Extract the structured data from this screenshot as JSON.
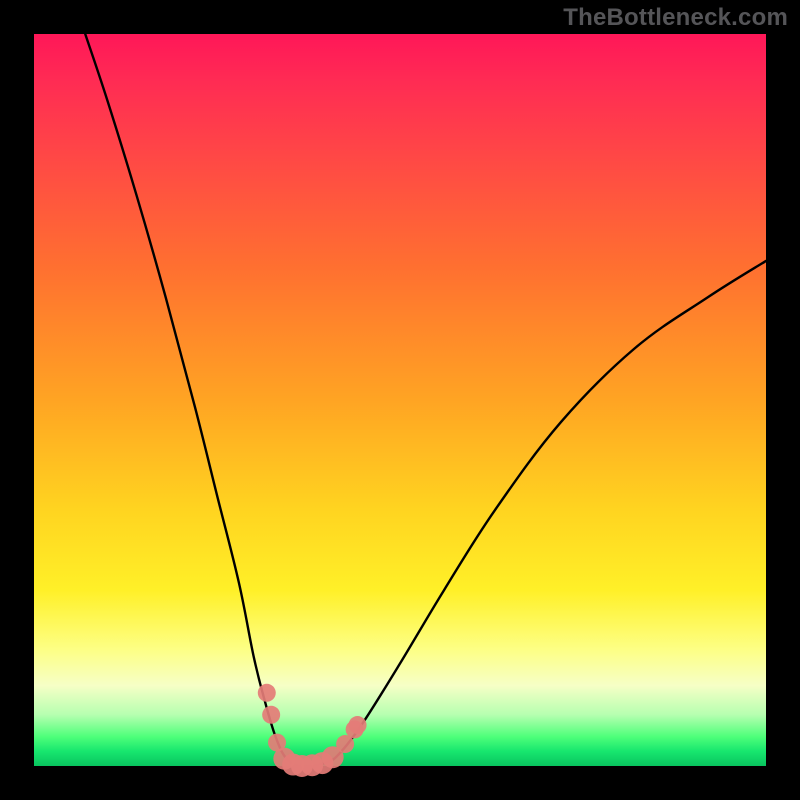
{
  "watermark": "TheBottleneck.com",
  "chart_data": {
    "type": "line",
    "title": "",
    "xlabel": "",
    "ylabel": "",
    "xlim": [
      0,
      100
    ],
    "ylim": [
      0,
      100
    ],
    "curve": {
      "left_branch": [
        {
          "x": 7,
          "y": 100
        },
        {
          "x": 10,
          "y": 91
        },
        {
          "x": 14,
          "y": 78
        },
        {
          "x": 18,
          "y": 64
        },
        {
          "x": 22,
          "y": 49
        },
        {
          "x": 25,
          "y": 37
        },
        {
          "x": 28,
          "y": 25
        },
        {
          "x": 30,
          "y": 15
        },
        {
          "x": 31.5,
          "y": 9
        },
        {
          "x": 33,
          "y": 4
        },
        {
          "x": 34.5,
          "y": 1
        },
        {
          "x": 36.5,
          "y": 0
        }
      ],
      "right_branch": [
        {
          "x": 36.5,
          "y": 0
        },
        {
          "x": 40,
          "y": 0.5
        },
        {
          "x": 42,
          "y": 2
        },
        {
          "x": 45,
          "y": 6
        },
        {
          "x": 50,
          "y": 14
        },
        {
          "x": 56,
          "y": 24
        },
        {
          "x": 63,
          "y": 35
        },
        {
          "x": 72,
          "y": 47
        },
        {
          "x": 82,
          "y": 57
        },
        {
          "x": 92,
          "y": 64
        },
        {
          "x": 100,
          "y": 69
        }
      ]
    },
    "markers": [
      {
        "x": 31.8,
        "y": 10.0,
        "emphasis": false
      },
      {
        "x": 32.4,
        "y": 7.0,
        "emphasis": false
      },
      {
        "x": 33.2,
        "y": 3.2,
        "emphasis": false
      },
      {
        "x": 34.2,
        "y": 1.0,
        "emphasis": true
      },
      {
        "x": 35.4,
        "y": 0.2,
        "emphasis": true
      },
      {
        "x": 36.6,
        "y": 0.0,
        "emphasis": true
      },
      {
        "x": 38.0,
        "y": 0.1,
        "emphasis": true
      },
      {
        "x": 39.4,
        "y": 0.4,
        "emphasis": true
      },
      {
        "x": 40.8,
        "y": 1.2,
        "emphasis": true
      },
      {
        "x": 42.5,
        "y": 3.0,
        "emphasis": false
      },
      {
        "x": 43.8,
        "y": 5.0,
        "emphasis": false
      },
      {
        "x": 44.2,
        "y": 5.6,
        "emphasis": false
      }
    ],
    "marker_color": "#e47c77",
    "gradient_colors": {
      "top": "#ff1758",
      "mid": "#ffd420",
      "bottom": "#09c45f"
    }
  }
}
